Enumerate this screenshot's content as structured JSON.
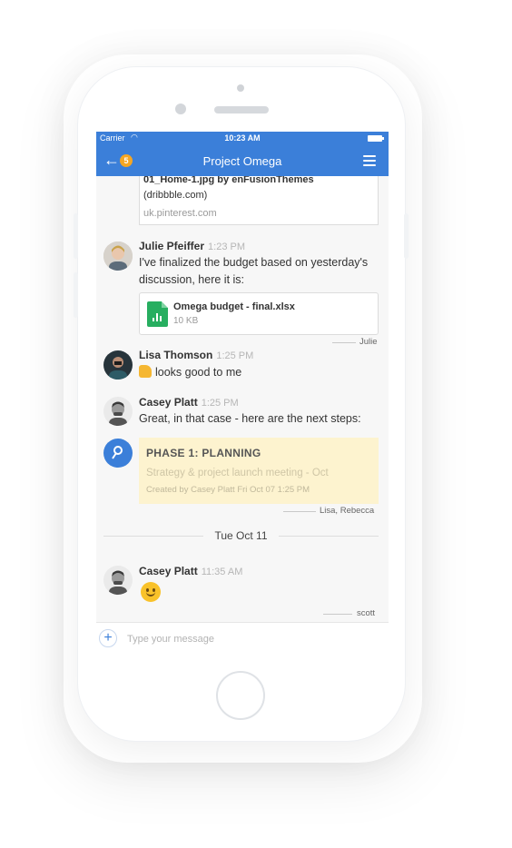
{
  "statusbar": {
    "carrier": "Carrier",
    "time": "10:23 AM"
  },
  "navbar": {
    "title": "Project Omega",
    "badge": "5"
  },
  "link_preview": {
    "title": "01_Home-1.jpg by enFusionThemes",
    "subtitle": "(dribbble.com)",
    "domain": "uk.pinterest.com"
  },
  "messages": [
    {
      "name": "Julie Pfeiffer",
      "time": "1:23 PM",
      "text_line1": "I've finalized the budget based on yesterday's",
      "text_line2": "discussion, here it is:",
      "attachment": {
        "file_name": "Omega budget - final.xlsx",
        "file_size": "10 KB"
      },
      "read_by": "Julie"
    },
    {
      "name": "Lisa Thomson",
      "time": "1:25 PM",
      "text": "looks good to me"
    },
    {
      "name": "Casey Platt",
      "time": "1:25 PM",
      "text": "Great, in that case - here are the next steps:",
      "task": {
        "title": "PHASE 1: PLANNING",
        "description": "Strategy & project launch meeting - Oct",
        "meta": "Created by Casey Platt Fri Oct 07 1:25 PM"
      },
      "read_by": "Lisa, Rebecca"
    },
    {
      "name": "Casey Platt",
      "time": "11:35 AM",
      "read_by": "scott"
    }
  ],
  "date_separator": "Tue Oct 11",
  "composer": {
    "placeholder": "Type your message"
  },
  "colors": {
    "primary": "#3b7fd9",
    "badge": "#f5a623",
    "task_bg": "#fdf3cf",
    "excel_green": "#27ae60"
  }
}
